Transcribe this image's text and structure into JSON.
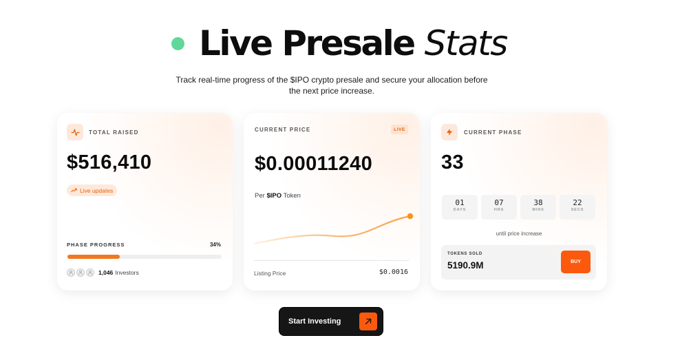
{
  "header": {
    "title_bold": "Live Presale",
    "title_italic": "Stats",
    "subtitle": "Track real-time progress of the $IPO crypto presale and secure your allocation before the next price increase."
  },
  "cards": {
    "total_raised": {
      "label": "TOTAL RAISED",
      "value": "$516,410",
      "badge": "Live updates",
      "phase_progress_label": "PHASE PROGRESS",
      "phase_progress_value": "34%",
      "phase_progress_fraction": 0.34,
      "investors_count": "1,046",
      "investors_label": "Investors"
    },
    "current_price": {
      "label": "CURRENT PRICE",
      "live_badge": "LIVE",
      "value": "$0.00011240",
      "per_prefix": "Per",
      "per_token": "$IPO",
      "per_suffix": "Token",
      "listing_label": "Listing Price",
      "listing_value": "$0.0016"
    },
    "current_phase": {
      "label": "CURRENT PHASE",
      "value": "33",
      "countdown": [
        {
          "num": "01",
          "unit": "DAYS"
        },
        {
          "num": "07",
          "unit": "HRS"
        },
        {
          "num": "38",
          "unit": "MINS"
        },
        {
          "num": "22",
          "unit": "SECS"
        }
      ],
      "until_text": "until price increase",
      "tokens_sold_label": "TOKENS SOLD",
      "tokens_sold_value": "5190.9M",
      "buy_label": "BUY"
    }
  },
  "cta": {
    "label": "Start Investing"
  },
  "colors": {
    "accent": "#fb5a0e",
    "accent_soft": "#fde8dc",
    "green_dot": "#5fd89a",
    "dark": "#161616"
  },
  "icons": {
    "total_raised": "activity-pulse-icon",
    "badge": "trending-up-icon",
    "current_phase": "lightning-bolt-icon",
    "cta": "arrow-up-right-icon"
  }
}
